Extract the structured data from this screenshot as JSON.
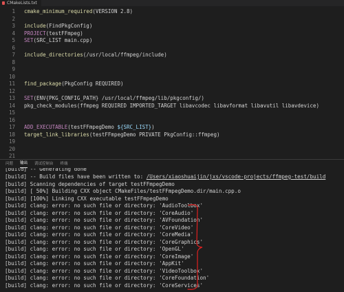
{
  "tab": {
    "label": "CMakeLists.txt",
    "icon": "cmake-file-icon"
  },
  "editor": {
    "lines": [
      {
        "n": "1",
        "parts": [
          {
            "t": "cmake_minimum_required",
            "c": "kw"
          },
          {
            "t": "(VERSION 2.8)",
            "c": "arg"
          }
        ]
      },
      {
        "n": "2",
        "parts": []
      },
      {
        "n": "3",
        "parts": [
          {
            "t": "include",
            "c": "kw"
          },
          {
            "t": "(FindPkgConfig)",
            "c": "arg"
          }
        ]
      },
      {
        "n": "4",
        "parts": [
          {
            "t": "PROJECT",
            "c": "kw2"
          },
          {
            "t": "(testFFmpeg)",
            "c": "arg"
          }
        ]
      },
      {
        "n": "5",
        "parts": [
          {
            "t": "SET",
            "c": "kw2"
          },
          {
            "t": "(SRC_LIST main.cpp)",
            "c": "arg"
          }
        ]
      },
      {
        "n": "6",
        "parts": []
      },
      {
        "n": "7",
        "parts": [
          {
            "t": "include_directories",
            "c": "kw"
          },
          {
            "t": "(/usr/local/ffmpeg/include)",
            "c": "arg"
          }
        ]
      },
      {
        "n": "8",
        "parts": []
      },
      {
        "n": "9",
        "parts": []
      },
      {
        "n": "10",
        "parts": []
      },
      {
        "n": "11",
        "parts": [
          {
            "t": "find_package",
            "c": "kw"
          },
          {
            "t": "(PkgConfig REQUIRED)",
            "c": "arg"
          }
        ]
      },
      {
        "n": "12",
        "parts": []
      },
      {
        "n": "13",
        "parts": [
          {
            "t": "SET",
            "c": "kw2"
          },
          {
            "t": "(ENV{PKG_CONFIG_PATH} /usr/local/ffmpeg/lib/pkgconfig/)",
            "c": "arg"
          }
        ]
      },
      {
        "n": "14",
        "parts": [
          {
            "t": "pkg_check_modules(ffmpeg REQUIRED IMPORTED_TARGET libavcodec libavformat libavutil libavdevice)",
            "c": "arg"
          }
        ]
      },
      {
        "n": "15",
        "parts": []
      },
      {
        "n": "16",
        "parts": []
      },
      {
        "n": "17",
        "parts": [
          {
            "t": "ADD_EXECUTABLE",
            "c": "kw2"
          },
          {
            "t": "(testFFmpegDemo ",
            "c": "arg"
          },
          {
            "t": "${SRC_LIST}",
            "c": "var"
          },
          {
            "t": ")",
            "c": "arg"
          }
        ]
      },
      {
        "n": "18",
        "parts": [
          {
            "t": "target_link_libraries",
            "c": "kw"
          },
          {
            "t": "(testFFmpegDemo PRIVATE PkgConfig::ffmpeg)",
            "c": "arg"
          }
        ]
      },
      {
        "n": "19",
        "parts": []
      },
      {
        "n": "20",
        "parts": []
      },
      {
        "n": "21",
        "parts": []
      }
    ]
  },
  "panel": {
    "tabs": [
      "问题",
      "输出",
      "调试控制台",
      "终端"
    ],
    "active_tab": 1,
    "partial_line": "[build] -- Generating done",
    "output_lines": [
      "[build] -- Build files have been written to: /Users/xiaoshuaijin/jxs/vscode-projects/ffmpeg-test/build",
      "[build] Scanning dependencies of target testFFmpegDemo",
      "[build] [ 50%] Building CXX object CMakeFiles/testFFmpegDemo.dir/main.cpp.o",
      "[build] [100%] Linking CXX executable testFFmpegDemo",
      "[build] clang: error: no such file or directory: 'AudioToolbox'",
      "[build] clang: error: no such file or directory: 'CoreAudio'",
      "[build] clang: error: no such file or directory: 'AVFoundation'",
      "[build] clang: error: no such file or directory: 'CoreVideo'",
      "[build] clang: error: no such file or directory: 'CoreMedia'",
      "[build] clang: error: no such file or directory: 'CoreGraphics'",
      "[build] clang: error: no such file or directory: 'OpenGL'",
      "[build] clang: error: no such file or directory: 'CoreImage'",
      "[build] clang: error: no such file or directory: 'AppKit'",
      "[build] clang: error: no such file or directory: 'VideoToolbox'",
      "[build] clang: error: no such file or directory: 'CoreFoundation'",
      "[build] clang: error: no such file or directory: 'CoreServices'"
    ]
  },
  "colors": {
    "background": "#1e1e1e",
    "function": "#dcdcaa",
    "keyword": "#c586c0",
    "variable": "#9cdcfe",
    "line_number": "#858585",
    "annotation": "#e02020"
  }
}
